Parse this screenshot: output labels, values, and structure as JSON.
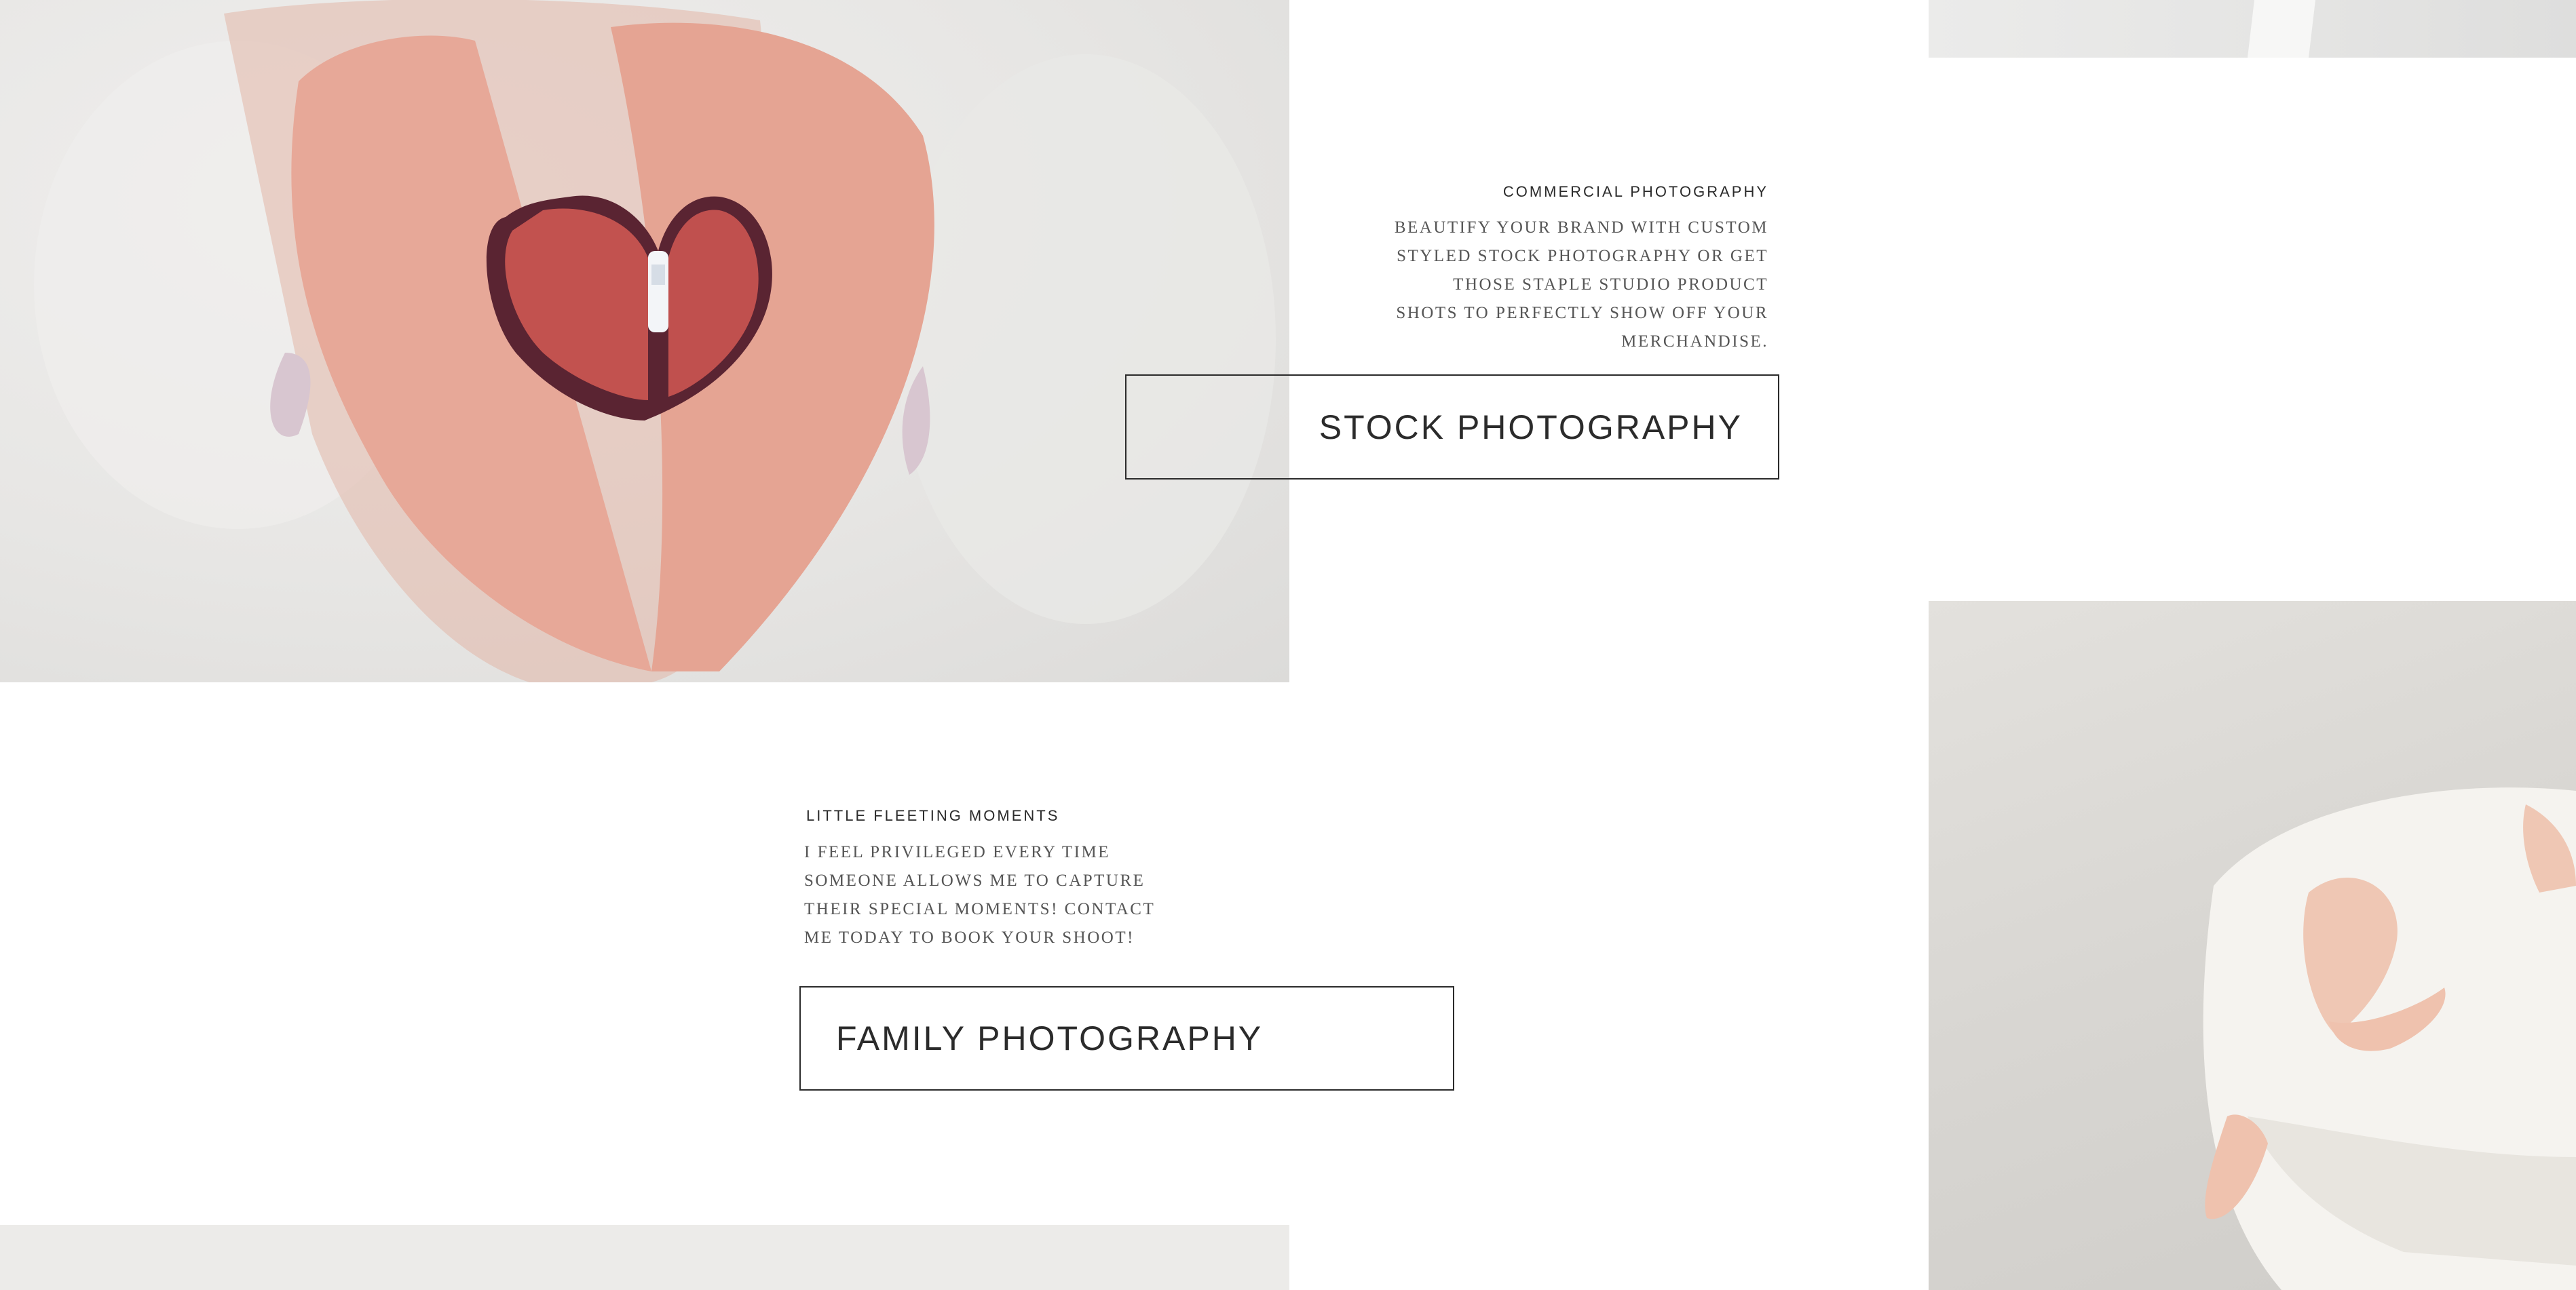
{
  "colors": {
    "background": "#ffffff",
    "text": "#2b2b2b",
    "body_text": "#555555",
    "button_border": "#2b2b2b"
  },
  "sections": {
    "stock": {
      "eyebrow": "COMMERCIAL  PHOTOGRAPHY",
      "blurb_lines": [
        "BEAUTIFY YOUR BRAND WITH CUSTOM",
        "STYLED STOCK PHOTOGRAPHY OR GET",
        "THOSE STAPLE STUDIO PRODUCT",
        "SHOTS TO PERFECTLY SHOW OFF YOUR",
        "MERCHANDISE."
      ],
      "button_label": "STOCK PHOTOGRAPHY"
    },
    "family": {
      "eyebrow": "LITTLE FLEETING MOMENTS",
      "blurb_lines": [
        "I FEEL PRIVILEGED EVERY TIME",
        "SOMEONE ALLOWS ME TO CAPTURE",
        "THEIR SPECIAL MOMENTS!  CONTACT",
        "ME TODAY TO BOOK YOUR SHOOT!"
      ],
      "button_label": "FAMILY PHOTOGRAPHY"
    }
  }
}
